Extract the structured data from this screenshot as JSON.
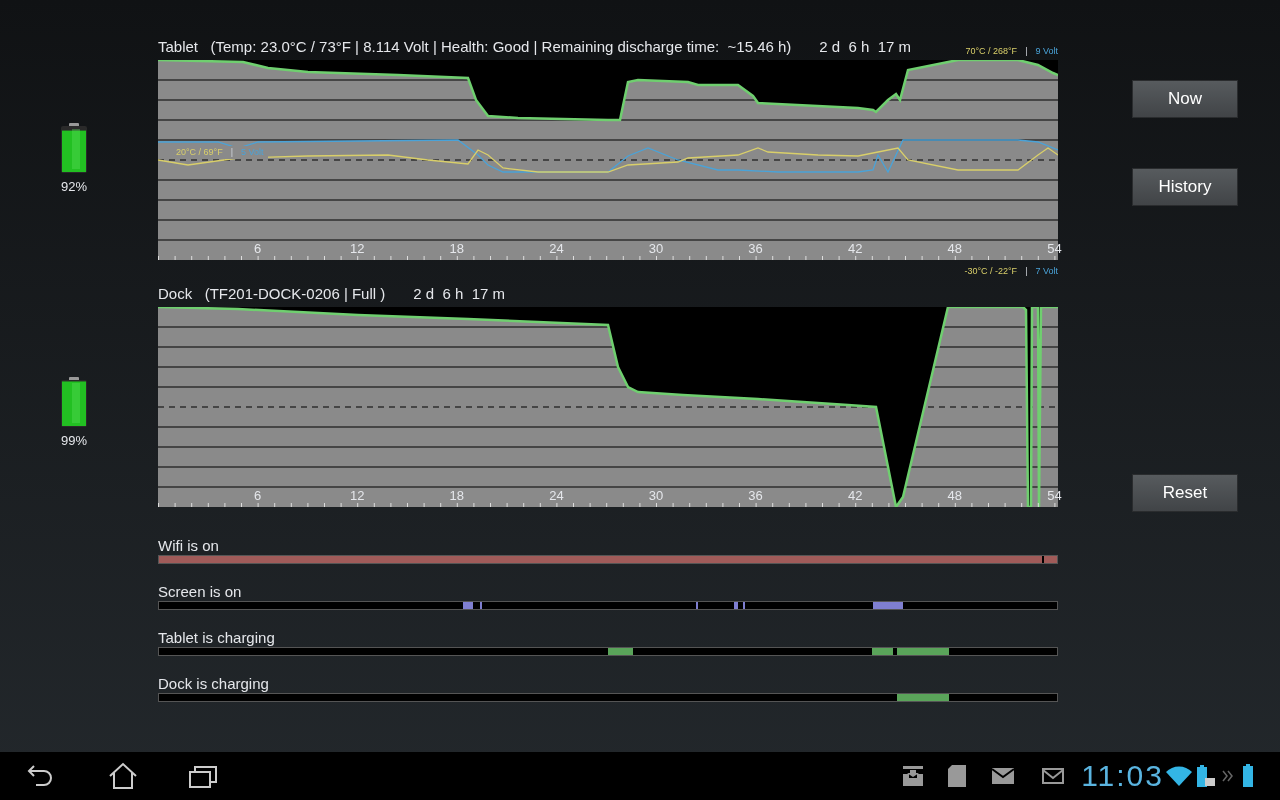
{
  "batteries": [
    {
      "label": "92%",
      "level": 0.92
    },
    {
      "label": "99%",
      "level": 0.99
    }
  ],
  "charts": [
    {
      "title": "Tablet   (Temp: 23.0°C / 73°F | 8.114 Volt | Health: Good | Remaining discharge time:  ~15.46 h)",
      "duration": "2 d  6 h  17 m",
      "legend_top": {
        "temp": "70°C / 268°F",
        "separator": "|",
        "volt": "9 Volt"
      },
      "legend_mid": {
        "temp": "20°C / 69°F",
        "separator": "|",
        "volt": "5 Volt"
      },
      "legend_bottom": {
        "temp": "-30°C / -22°F",
        "separator": "|",
        "volt": "7 Volt"
      },
      "xticks": [
        "6",
        "12",
        "18",
        "24",
        "30",
        "36",
        "42",
        "48",
        "54"
      ],
      "kind": "tablet"
    },
    {
      "title": "Dock   (TF201-DOCK-0206 | Full )",
      "duration": "2 d  6 h  17 m",
      "xticks": [
        "6",
        "12",
        "18",
        "24",
        "30",
        "36",
        "42",
        "48",
        "54"
      ],
      "kind": "dock"
    }
  ],
  "buttons": [
    {
      "label": "Now"
    },
    {
      "label": "History"
    },
    {
      "label": "Reset"
    }
  ],
  "timelines": [
    {
      "label": "Wifi is on",
      "kind": "wifi",
      "color": "#a05b59"
    },
    {
      "label": "Screen is on",
      "kind": "screen",
      "color": "#7f7fd0"
    },
    {
      "label": "Tablet is charging",
      "kind": "tablet",
      "color": "#5aa45a"
    },
    {
      "label": "Dock is charging",
      "kind": "dock",
      "color": "#5aa45a"
    }
  ],
  "status_bar": {
    "time": "11:03"
  }
}
